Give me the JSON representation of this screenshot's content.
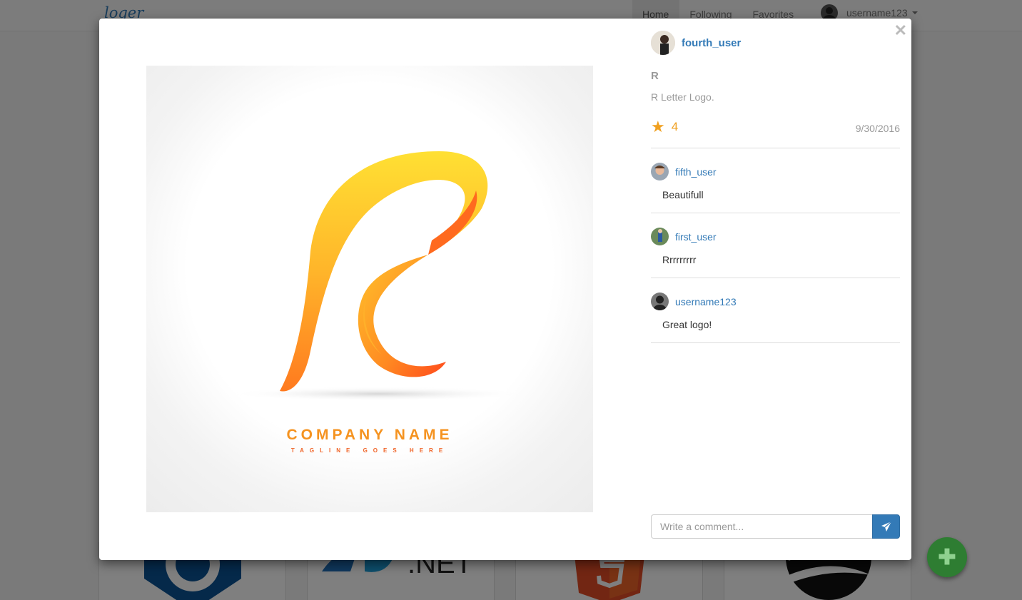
{
  "app": {
    "brand": "loger"
  },
  "nav": {
    "links": [
      "Home",
      "Following",
      "Favorites"
    ],
    "username": "username123"
  },
  "post": {
    "author": "fourth_user",
    "title": "R",
    "description": "R Letter Logo.",
    "rating": "4",
    "date": "9/30/2016",
    "image": {
      "company_name": "COMPANY NAME",
      "tagline": "TAGLINE GOES HERE"
    }
  },
  "comments": [
    {
      "user": "fifth_user",
      "text": "Beautifull"
    },
    {
      "user": "first_user",
      "text": "Rrrrrrrrr"
    },
    {
      "user": "username123",
      "text": "Great logo!"
    }
  ],
  "comment_form": {
    "placeholder": "Write a comment..."
  },
  "icons": {
    "close": "close-icon",
    "star": "star-icon",
    "send": "send-icon",
    "add": "plus-icon",
    "caret": "chevron-down-icon"
  },
  "colors": {
    "primary": "#337ab7",
    "rating": "#f0a020",
    "fab": "#2e7d32"
  }
}
